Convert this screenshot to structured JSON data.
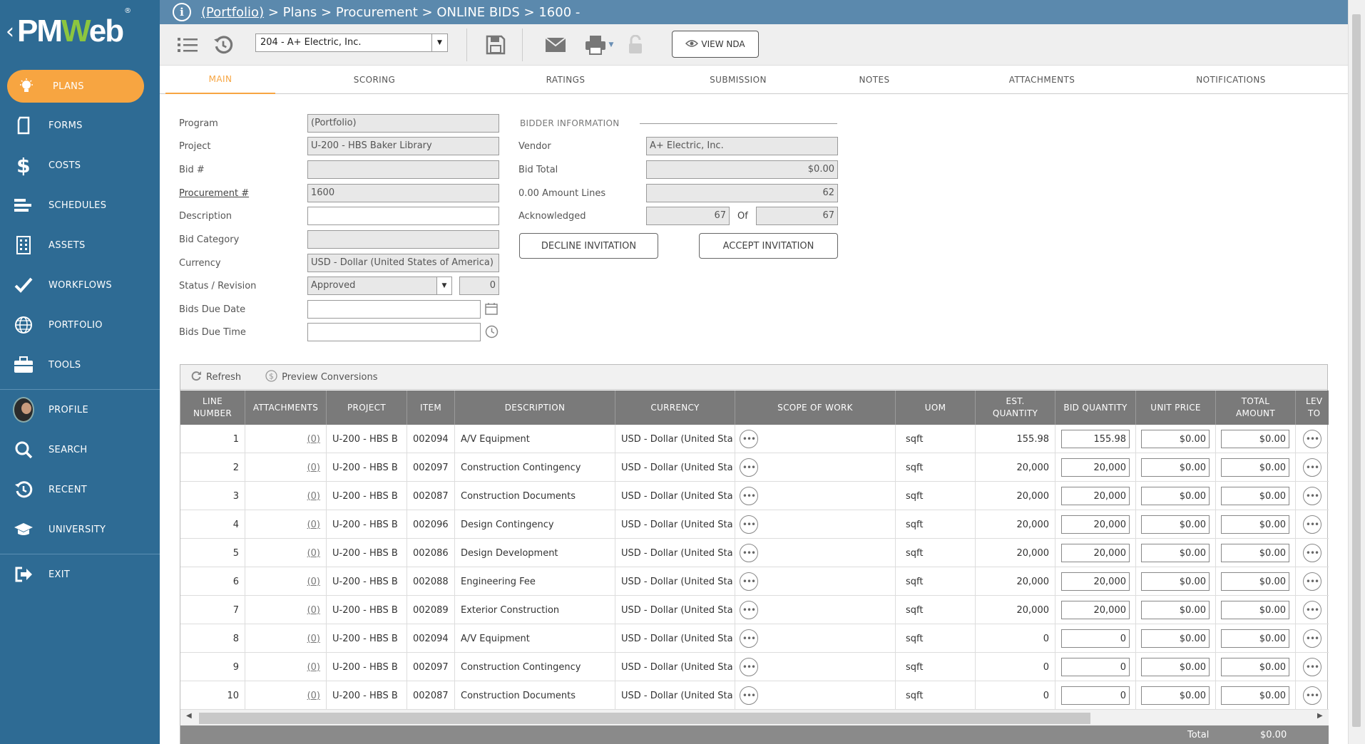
{
  "app": {
    "logo_pre": "PM",
    "logo_w": "W",
    "logo_post": "eb",
    "logo_reg": "®"
  },
  "sidebar": {
    "items": [
      {
        "label": "PLANS",
        "icon": "lightbulb-icon",
        "active": true
      },
      {
        "label": "FORMS",
        "icon": "document-icon"
      },
      {
        "label": "COSTS",
        "icon": "dollar-icon"
      },
      {
        "label": "SCHEDULES",
        "icon": "schedule-bars-icon"
      },
      {
        "label": "ASSETS",
        "icon": "building-icon"
      },
      {
        "label": "WORKFLOWS",
        "icon": "checkmark-icon"
      },
      {
        "label": "PORTFOLIO",
        "icon": "globe-icon"
      },
      {
        "label": "TOOLS",
        "icon": "briefcase-icon"
      },
      {
        "label": "PROFILE",
        "icon": "avatar"
      },
      {
        "label": "SEARCH",
        "icon": "search-icon"
      },
      {
        "label": "RECENT",
        "icon": "history-icon"
      },
      {
        "label": "UNIVERSITY",
        "icon": "graduation-cap-icon"
      },
      {
        "label": "EXIT",
        "icon": "exit-icon"
      }
    ]
  },
  "breadcrumb": {
    "portfolio": "(Portfolio)",
    "rest": " > Plans > Procurement > ONLINE BIDS > 1600 -"
  },
  "toolbar": {
    "vendor_value": "204 - A+ Electric, Inc.",
    "view_nda": "VIEW NDA"
  },
  "tabs": [
    "MAIN",
    "SCORING",
    "RATINGS",
    "SUBMISSION",
    "NOTES",
    "ATTACHMENTS",
    "NOTIFICATIONS"
  ],
  "form": {
    "program_label": "Program",
    "program_value": "(Portfolio)",
    "project_label": "Project",
    "project_value": "U-200 - HBS Baker Library",
    "bid_label": "Bid #",
    "bid_value": "",
    "procurement_label": "Procurement #",
    "procurement_value": "1600",
    "description_label": "Description",
    "description_value": "",
    "bid_category_label": "Bid Category",
    "bid_category_value": "",
    "currency_label": "Currency",
    "currency_value": "USD - Dollar (United States of America)",
    "status_label": "Status / Revision",
    "status_value": "Approved",
    "revision_value": "0",
    "due_date_label": "Bids Due Date",
    "due_date_value": "",
    "due_time_label": "Bids Due Time",
    "due_time_value": ""
  },
  "bidder": {
    "section_title": "BIDDER INFORMATION",
    "vendor_label": "Vendor",
    "vendor_value": "A+ Electric, Inc.",
    "bid_total_label": "Bid Total",
    "bid_total_value": "$0.00",
    "amount_lines_label": "0.00 Amount Lines",
    "amount_lines_value": "62",
    "acknowledged_label": "Acknowledged",
    "acknowledged_value": "67",
    "of_label": "Of",
    "of_value": "67",
    "decline_label": "DECLINE INVITATION",
    "accept_label": "ACCEPT INVITATION"
  },
  "grid": {
    "refresh_label": "Refresh",
    "preview_label": "Preview Conversions",
    "headers": {
      "line_number": "LINE\nNUMBER",
      "attachments": "ATTACHMENTS",
      "project": "PROJECT",
      "item": "ITEM",
      "description": "DESCRIPTION",
      "currency": "CURRENCY",
      "scope": "SCOPE OF WORK",
      "uom": "UOM",
      "est_quantity": "EST.\nQUANTITY",
      "bid_quantity": "BID QUANTITY",
      "unit_price": "UNIT PRICE",
      "total_amount": "TOTAL\nAMOUNT",
      "lev": "LEV\nTO"
    },
    "rows": [
      {
        "line": "1",
        "att": "(0)",
        "project": "U-200 - HBS B",
        "item": "002094",
        "desc": "A/V Equipment",
        "cur": "USD - Dollar (United Sta",
        "uom": "sqft",
        "est": "155.98",
        "bidq": "155.98",
        "price": "$0.00",
        "total": "$0.00"
      },
      {
        "line": "2",
        "att": "(0)",
        "project": "U-200 - HBS B",
        "item": "002097",
        "desc": "Construction Contingency",
        "cur": "USD - Dollar (United Sta",
        "uom": "sqft",
        "est": "20,000",
        "bidq": "20,000",
        "price": "$0.00",
        "total": "$0.00"
      },
      {
        "line": "3",
        "att": "(0)",
        "project": "U-200 - HBS B",
        "item": "002087",
        "desc": "Construction Documents",
        "cur": "USD - Dollar (United Sta",
        "uom": "sqft",
        "est": "20,000",
        "bidq": "20,000",
        "price": "$0.00",
        "total": "$0.00"
      },
      {
        "line": "4",
        "att": "(0)",
        "project": "U-200 - HBS B",
        "item": "002096",
        "desc": "Design Contingency",
        "cur": "USD - Dollar (United Sta",
        "uom": "sqft",
        "est": "20,000",
        "bidq": "20,000",
        "price": "$0.00",
        "total": "$0.00"
      },
      {
        "line": "5",
        "att": "(0)",
        "project": "U-200 - HBS B",
        "item": "002086",
        "desc": "Design Development",
        "cur": "USD - Dollar (United Sta",
        "uom": "sqft",
        "est": "20,000",
        "bidq": "20,000",
        "price": "$0.00",
        "total": "$0.00"
      },
      {
        "line": "6",
        "att": "(0)",
        "project": "U-200 - HBS B",
        "item": "002088",
        "desc": "Engineering Fee",
        "cur": "USD - Dollar (United Sta",
        "uom": "sqft",
        "est": "20,000",
        "bidq": "20,000",
        "price": "$0.00",
        "total": "$0.00"
      },
      {
        "line": "7",
        "att": "(0)",
        "project": "U-200 - HBS B",
        "item": "002089",
        "desc": "Exterior Construction",
        "cur": "USD - Dollar (United Sta",
        "uom": "sqft",
        "est": "20,000",
        "bidq": "20,000",
        "price": "$0.00",
        "total": "$0.00"
      },
      {
        "line": "8",
        "att": "(0)",
        "project": "U-200 - HBS B",
        "item": "002094",
        "desc": "A/V Equipment",
        "cur": "USD - Dollar (United Sta",
        "uom": "sqft",
        "est": "0",
        "bidq": "0",
        "price": "$0.00",
        "total": "$0.00"
      },
      {
        "line": "9",
        "att": "(0)",
        "project": "U-200 - HBS B",
        "item": "002097",
        "desc": "Construction Contingency",
        "cur": "USD - Dollar (United Sta",
        "uom": "sqft",
        "est": "0",
        "bidq": "0",
        "price": "$0.00",
        "total": "$0.00"
      },
      {
        "line": "10",
        "att": "(0)",
        "project": "U-200 - HBS B",
        "item": "002087",
        "desc": "Construction Documents",
        "cur": "USD - Dollar (United Sta",
        "uom": "sqft",
        "est": "0",
        "bidq": "0",
        "price": "$0.00",
        "total": "$0.00"
      }
    ],
    "footer_total_label": "Total",
    "footer_total_value": "$0.00"
  },
  "colors": {
    "sidebar": "#2e6b94",
    "accent": "#f7a541",
    "topbar": "#5b89ad",
    "grid_header": "#7a7a7a"
  }
}
